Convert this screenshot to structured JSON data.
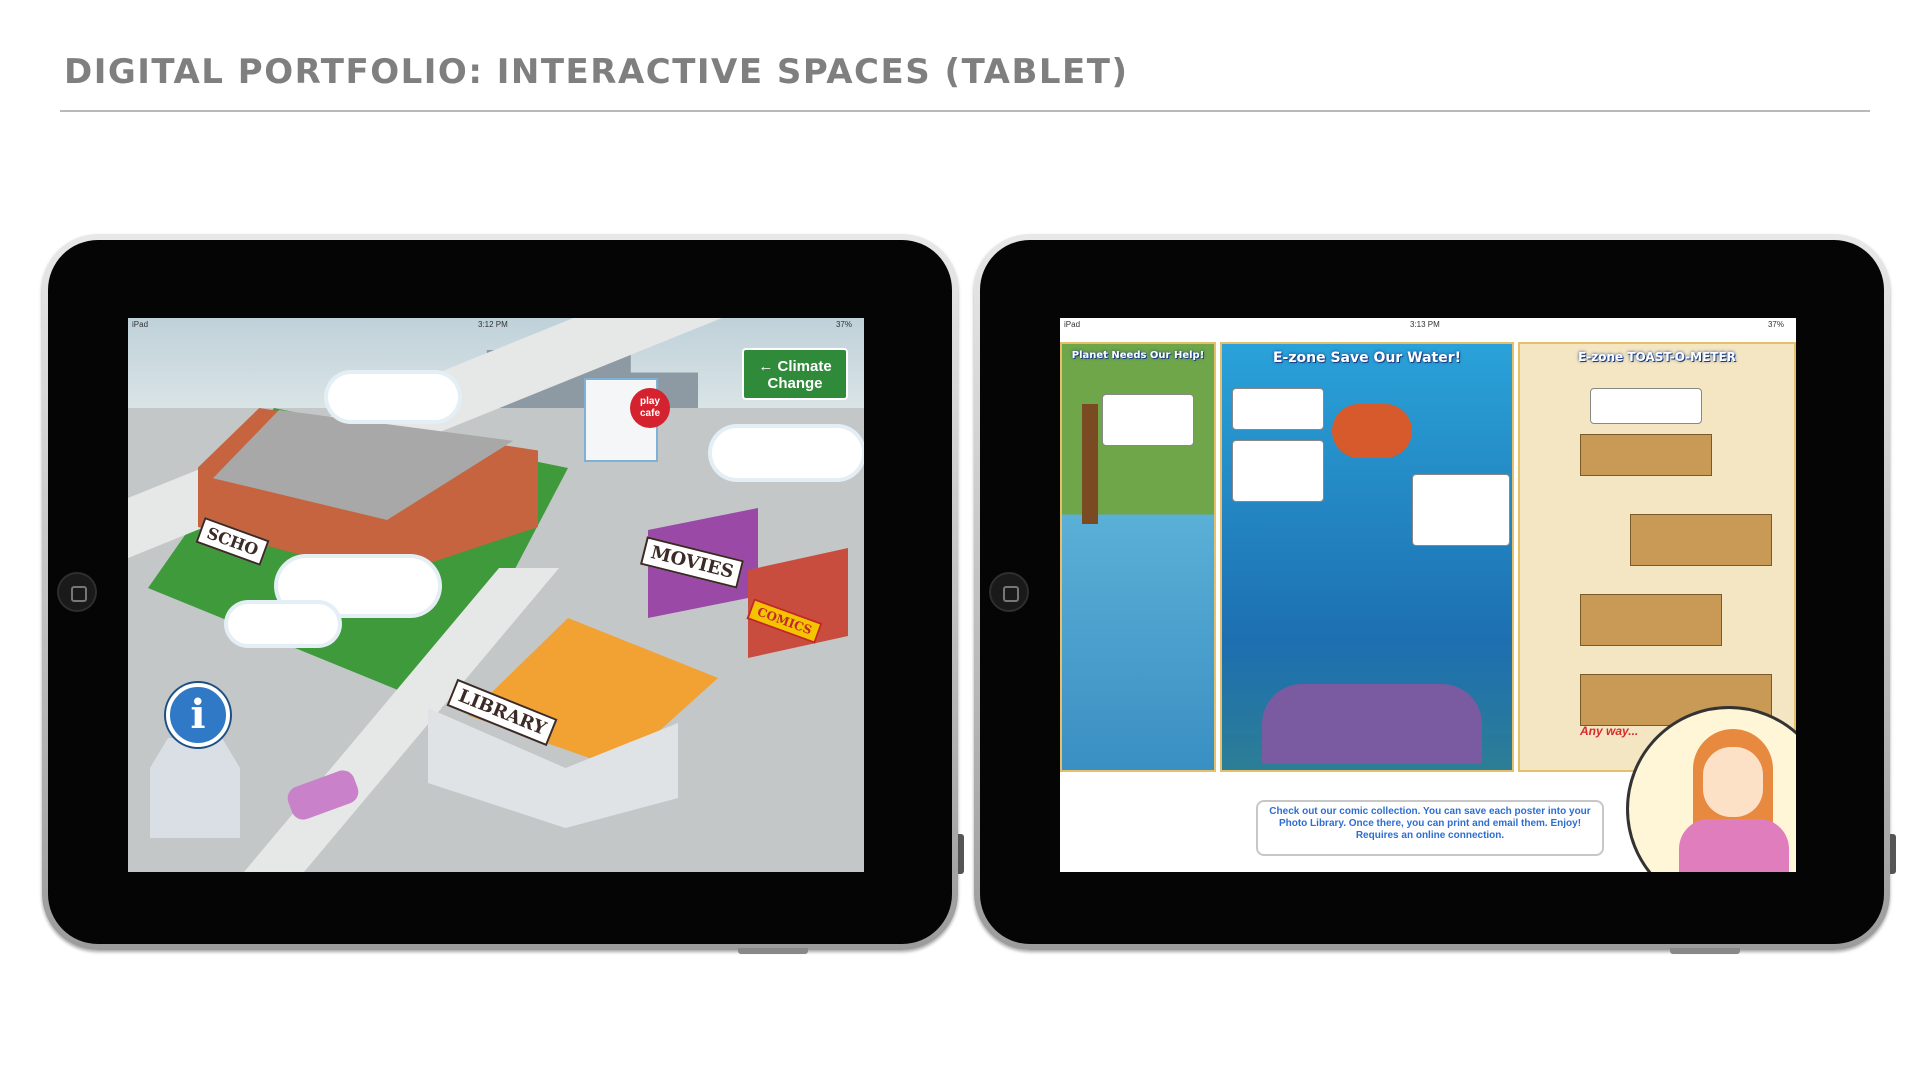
{
  "page": {
    "title": "DIGITAL PORTFOLIO: INTERACTIVE SPACES (TABLET)"
  },
  "left_tablet": {
    "status": {
      "carrier": "iPad",
      "time": "3:12 PM",
      "battery": "37%"
    },
    "sign": {
      "line1": "← Climate",
      "line2": "Change"
    },
    "labels": {
      "school": "SCHO",
      "movies": "MOVIES",
      "comics": "COMICS",
      "library": "LIBRARY",
      "cafe": "play cafe"
    },
    "icons": {
      "info": "i"
    }
  },
  "right_tablet": {
    "status": {
      "carrier": "iPad",
      "time": "3:13 PM",
      "battery": "37%"
    },
    "panels": [
      {
        "title": "Planet Needs Our Help!"
      },
      {
        "title": "E-zone   Save Our Water!"
      },
      {
        "title": "E-zone   TOAST-O-METER"
      }
    ],
    "panel3_tagline": "Any way...",
    "caption": "Check out our comic collection.  You can save each poster into your Photo Library. Once there, you can print and email them. Enjoy! Requires an online connection."
  }
}
